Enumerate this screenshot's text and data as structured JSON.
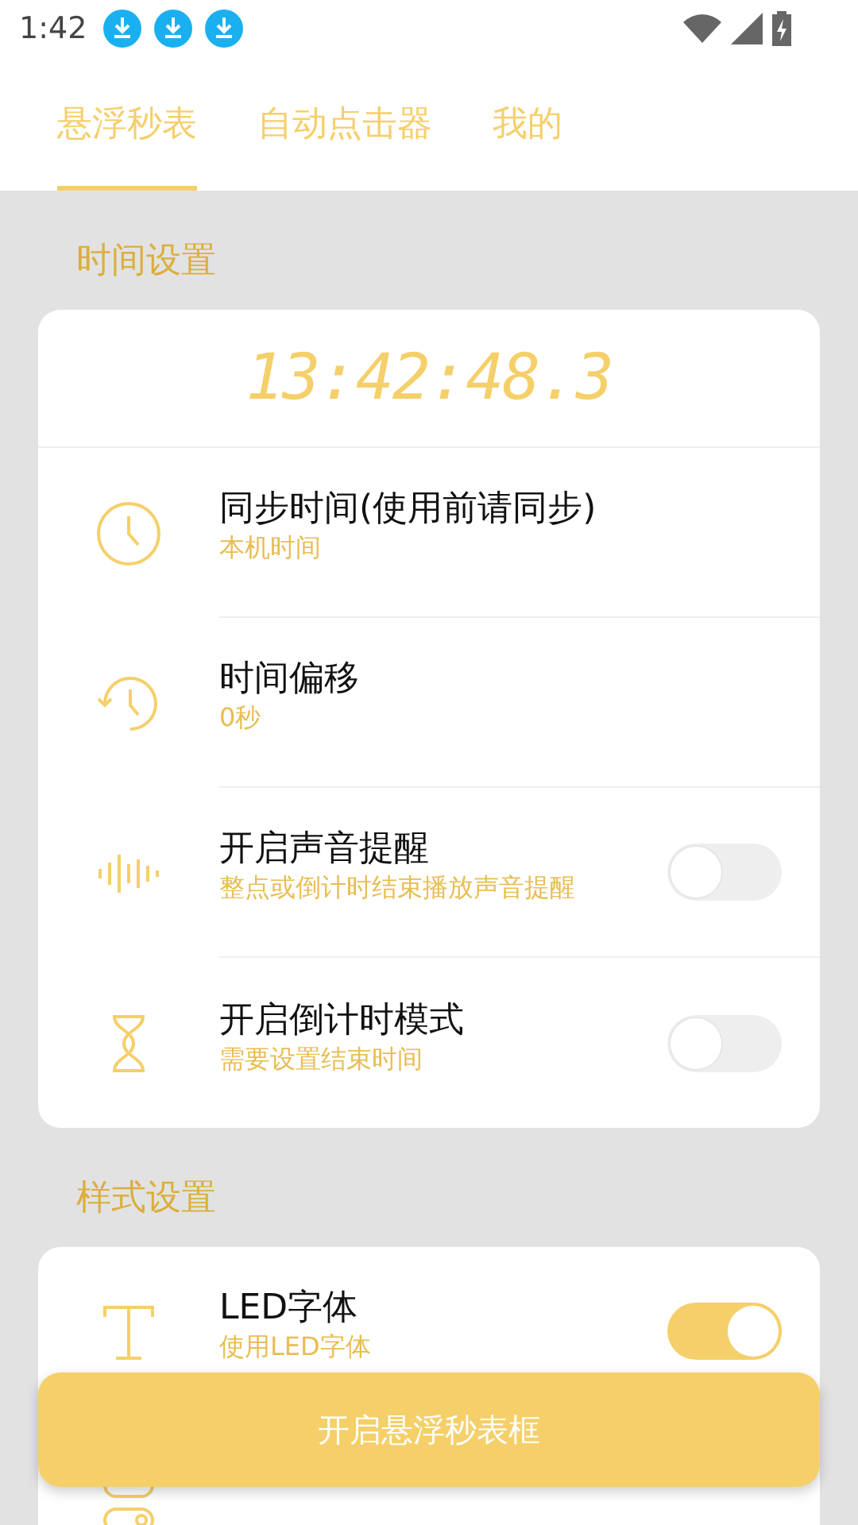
{
  "status_bar": {
    "time": "1:42",
    "notifications": [
      {
        "kind": "download"
      },
      {
        "kind": "download"
      },
      {
        "kind": "download"
      }
    ]
  },
  "tabs": [
    {
      "label": "悬浮秒表",
      "selected": true
    },
    {
      "label": "自动点击器",
      "selected": false
    },
    {
      "label": "我的",
      "selected": false
    }
  ],
  "sections": [
    {
      "title": "时间设置",
      "items": [
        {
          "kind": "display",
          "value": "13:42:48.3"
        },
        {
          "kind": "info",
          "title": "同步时间(使用前请同步)",
          "subtitle": "本机时间"
        },
        {
          "kind": "info",
          "title": "时间偏移",
          "subtitle": "0秒"
        },
        {
          "kind": "toggle",
          "title": "开启声音提醒",
          "subtitle": "整点或倒计时结束播放声音提醒",
          "on": false
        },
        {
          "kind": "toggle",
          "title": "开启倒计时模式",
          "subtitle": "需要设置结束时间",
          "on": false
        }
      ]
    },
    {
      "title": "样式设置",
      "items": [
        {
          "kind": "toggle",
          "title": "LED字体",
          "subtitle": "使用LED字体",
          "on": true
        },
        {
          "kind": "covered"
        }
      ]
    }
  ],
  "action_button": {
    "label": "开启悬浮秒表框"
  }
}
